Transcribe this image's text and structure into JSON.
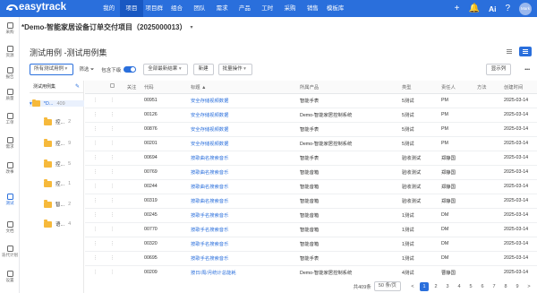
{
  "app": {
    "name": "easytrack"
  },
  "topnav": {
    "items": [
      "我的",
      "项目",
      "项目群",
      "组合",
      "团队",
      "需求",
      "产品",
      "工时",
      "采购",
      "销售",
      "模板库"
    ],
    "active": "项目"
  },
  "top_right": {
    "ai_label": "Ai",
    "avatar_text": "Mark"
  },
  "sidebar": [
    {
      "label": "采购",
      "icon": "cart-icon"
    },
    {
      "label": "资源",
      "icon": "resource-icon"
    },
    {
      "label": "报告",
      "icon": "report-icon"
    },
    {
      "label": "质量",
      "icon": "quality-icon"
    },
    {
      "label": "工单",
      "icon": "ticket-icon"
    },
    {
      "label": "需求",
      "icon": "requirement-icon"
    },
    {
      "label": "改事",
      "icon": "issue-icon"
    },
    {
      "label": "测试",
      "icon": "test-icon"
    },
    {
      "label": "文档",
      "icon": "doc-icon"
    },
    {
      "label": "迭代计划",
      "icon": "plan-icon"
    },
    {
      "label": "设置",
      "icon": "gear-icon"
    }
  ],
  "sidebar_active": "测试",
  "project": {
    "title": "*Demo-智能家居设备订单交付项目（2025000013）"
  },
  "page": {
    "breadcrumb": "测试用例 -测试用例集"
  },
  "toolbar": {
    "scope": "所有测试用例",
    "filter": "筛选",
    "include_sub": "包含下级",
    "results": "全部最新结果",
    "new": "新建",
    "bulk": "批量操作",
    "show_cols": "显示列",
    "more": "•••"
  },
  "tree": {
    "header": "测试用例集",
    "root": {
      "label": "*D...",
      "count": "409"
    },
    "children": [
      {
        "label": "控...",
        "count": "2"
      },
      {
        "label": "控...",
        "count": "9"
      },
      {
        "label": "控...",
        "count": "5"
      },
      {
        "label": "控...",
        "count": "1"
      },
      {
        "label": "智...",
        "count": "2"
      },
      {
        "label": "语...",
        "count": "4"
      }
    ]
  },
  "table": {
    "columns": [
      "",
      "",
      "关注",
      "代码",
      "标题 ▲",
      "所属产品",
      "类型",
      "责任人",
      "方法",
      "创建时间"
    ],
    "rows": [
      [
        "00951",
        "安全存储视频数据",
        "智能手表",
        "5测试",
        "PM",
        "",
        "2025-03-14"
      ],
      [
        "00126",
        "安全存储视频数据",
        "Demo-智能家居控制系统",
        "5测试",
        "PM",
        "",
        "2025-03-14"
      ],
      [
        "00876",
        "安全存储视频数据",
        "智能手表",
        "5测试",
        "PM",
        "",
        "2025-03-14"
      ],
      [
        "00201",
        "安全存储视频数据",
        "Demo-智能家居控制系统",
        "5测试",
        "PM",
        "",
        "2025-03-14"
      ],
      [
        "00694",
        "按歌曲名搜索音乐",
        "智能手表",
        "验收测试",
        "郑静国",
        "",
        "2025-03-14"
      ],
      [
        "00769",
        "按歌曲名搜索音乐",
        "智能音箱",
        "验收测试",
        "郑静国",
        "",
        "2025-03-14"
      ],
      [
        "00244",
        "按歌曲名搜索音乐",
        "智能音箱",
        "验收测试",
        "郑静国",
        "",
        "2025-03-14"
      ],
      [
        "00319",
        "按歌曲名搜索音乐",
        "智能音箱",
        "验收测试",
        "郑静国",
        "",
        "2025-03-14"
      ],
      [
        "00245",
        "按歌手名搜索音乐",
        "智能音箱",
        "1测试",
        "DM",
        "",
        "2025-03-14"
      ],
      [
        "00770",
        "按歌手名搜索音乐",
        "智能音箱",
        "1测试",
        "DM",
        "",
        "2025-03-14"
      ],
      [
        "00320",
        "按歌手名搜索音乐",
        "智能音箱",
        "1测试",
        "DM",
        "",
        "2025-03-14"
      ],
      [
        "00695",
        "按歌手名搜索音乐",
        "智能手表",
        "1测试",
        "DM",
        "",
        "2025-03-14"
      ],
      [
        "00209",
        "按日/周/月统计总能耗",
        "Demo-智能家居控制系统",
        "4测试",
        "曹静国",
        "",
        "2025-03-14"
      ]
    ]
  },
  "pagination": {
    "total": "共409条",
    "page_size": "50 条/页",
    "pages": [
      "1",
      "2",
      "3",
      "4",
      "5",
      "6",
      "7",
      "8",
      "9"
    ],
    "current": "1",
    "prev": "<",
    "next": ">"
  }
}
